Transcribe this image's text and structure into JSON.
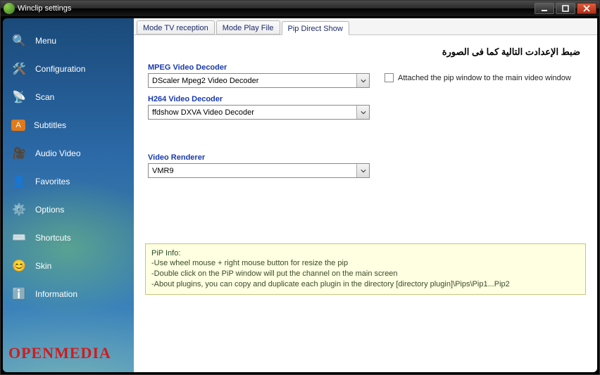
{
  "window": {
    "title": "Winclip settings"
  },
  "sidebar": {
    "items": [
      {
        "label": "Menu"
      },
      {
        "label": "Configuration"
      },
      {
        "label": "Scan"
      },
      {
        "label": "Subtitles"
      },
      {
        "label": "Audio Video"
      },
      {
        "label": "Favorites"
      },
      {
        "label": "Options"
      },
      {
        "label": "Shortcuts"
      },
      {
        "label": "Skin"
      },
      {
        "label": "Information"
      }
    ],
    "brand": "OPENMEDIA"
  },
  "tabs": [
    {
      "label": "Mode TV reception"
    },
    {
      "label": "Mode Play File"
    },
    {
      "label": "Pip Direct Show"
    }
  ],
  "panel": {
    "heading_rtl": "ضبط الإعدادت التالية كما فى الصورة",
    "mpeg_label": "MPEG Video Decoder",
    "mpeg_value": "DScaler Mpeg2 Video Decoder",
    "h264_label": "H264 Video Decoder",
    "h264_value": "ffdshow DXVA Video Decoder",
    "renderer_label": "Video Renderer",
    "renderer_value": "VMR9",
    "attach_label": "Attached the pip window to the main video window",
    "info_title": "PiP Info:",
    "info_line1": "-Use wheel mouse + right mouse button for resize the pip",
    "info_line2": "-Double click on the PiP window will put the channel on the main screen",
    "info_line3": "-About plugins, you can copy and duplicate each plugin in the directory [directory plugin]\\Pips\\Pip1...Pip2"
  }
}
